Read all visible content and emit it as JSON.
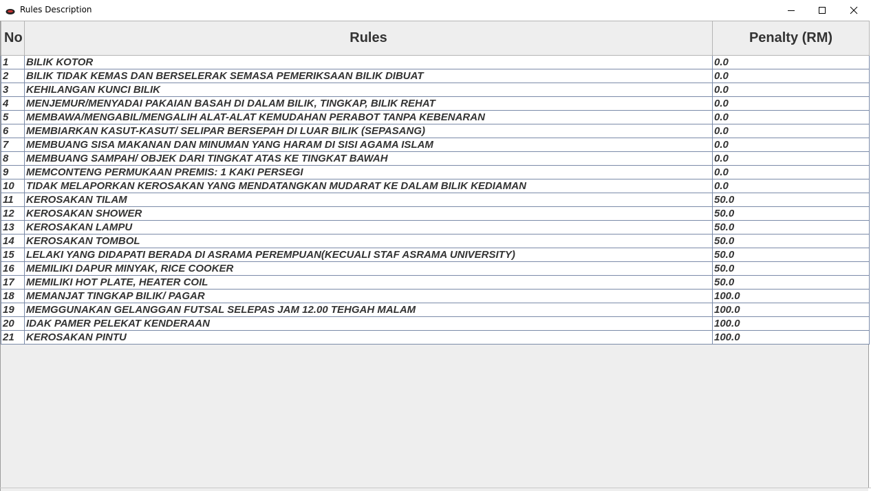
{
  "window": {
    "title": "Rules Description"
  },
  "table": {
    "columns": [
      "No",
      "Rules",
      "Penalty (RM)"
    ],
    "rows": [
      {
        "no": "1",
        "rule": "BILIK KOTOR",
        "penalty": "0.0"
      },
      {
        "no": "2",
        "rule": "BILIK TIDAK KEMAS DAN BERSELERAK SEMASA PEMERIKSAAN BILIK DIBUAT",
        "penalty": "0.0"
      },
      {
        "no": "3",
        "rule": "KEHILANGAN KUNCI BILIK",
        "penalty": "0.0"
      },
      {
        "no": "4",
        "rule": "MENJEMUR/MENYADAI PAKAIAN BASAH DI DALAM BILIK, TINGKAP, BILIK REHAT",
        "penalty": "0.0"
      },
      {
        "no": "5",
        "rule": "MEMBAWA/MENGABIL/MENGALIH ALAT-ALAT KEMUDAHAN PERABOT TANPA KEBENARAN",
        "penalty": "0.0"
      },
      {
        "no": "6",
        "rule": "MEMBIARKAN KASUT-KASUT/ SELIPAR BERSEPAH DI LUAR BILIK (SEPASANG)",
        "penalty": "0.0"
      },
      {
        "no": "7",
        "rule": "MEMBUANG SISA MAKANAN DAN MINUMAN YANG HARAM DI SISI AGAMA ISLAM",
        "penalty": "0.0"
      },
      {
        "no": "8",
        "rule": "MEMBUANG SAMPAH/ OBJEK DARI TINGKAT ATAS KE TINGKAT BAWAH",
        "penalty": "0.0"
      },
      {
        "no": "9",
        "rule": "MEMCONTENG PERMUKAAN PREMIS: 1 KAKI PERSEGI",
        "penalty": "0.0"
      },
      {
        "no": "10",
        "rule": "TIDAK MELAPORKAN KEROSAKAN YANG MENDATANGKAN MUDARAT KE DALAM BILIK KEDIAMAN",
        "penalty": "0.0"
      },
      {
        "no": "11",
        "rule": "KEROSAKAN TILAM",
        "penalty": "50.0"
      },
      {
        "no": "12",
        "rule": "KEROSAKAN SHOWER",
        "penalty": "50.0"
      },
      {
        "no": "13",
        "rule": "KEROSAKAN LAMPU",
        "penalty": "50.0"
      },
      {
        "no": "14",
        "rule": "KEROSAKAN TOMBOL",
        "penalty": "50.0"
      },
      {
        "no": "15",
        "rule": "LELAKI YANG DIDAPATI BERADA DI ASRAMA PEREMPUAN(KECUALI STAF ASRAMA UNIVERSITY)",
        "penalty": "50.0"
      },
      {
        "no": "16",
        "rule": "MEMILIKI DAPUR MINYAK, RICE COOKER",
        "penalty": "50.0"
      },
      {
        "no": "17",
        "rule": "MEMILIKI HOT PLATE, HEATER COIL",
        "penalty": "50.0"
      },
      {
        "no": "18",
        "rule": "MEMANJAT TINGKAP BILIK/ PAGAR",
        "penalty": "100.0"
      },
      {
        "no": "19",
        "rule": "MEMGGUNAKAN GELANGGAN FUTSAL SELEPAS JAM 12.00 TEHGAH MALAM",
        "penalty": "100.0"
      },
      {
        "no": "20",
        "rule": "IDAK PAMER PELEKAT KENDERAAN",
        "penalty": "100.0"
      },
      {
        "no": "21",
        "rule": "KEROSAKAN PINTU",
        "penalty": "100.0"
      }
    ]
  },
  "icons": {
    "app": "java-cup-icon",
    "minimize": "minimize-icon",
    "maximize": "maximize-icon",
    "close": "close-icon"
  }
}
